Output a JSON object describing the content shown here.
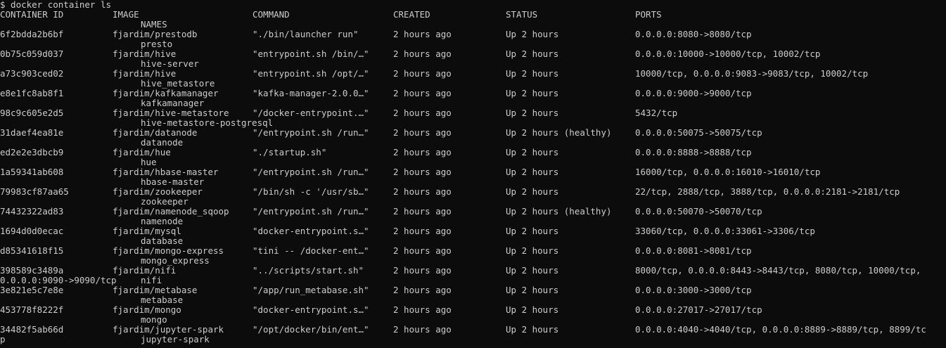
{
  "prompt": "$ docker container ls",
  "headers": {
    "container_id": "CONTAINER ID",
    "image": "IMAGE",
    "command": "COMMAND",
    "created": "CREATED",
    "status": "STATUS",
    "ports": "PORTS",
    "names": "NAMES"
  },
  "containers": [
    {
      "id": "6f2bdda2b6bf",
      "image": "fjardim/prestodb",
      "command": "\"./bin/launcher run\"",
      "created": "2 hours ago",
      "status": "Up 2 hours",
      "ports": "0.0.0.0:8080->8080/tcp",
      "ports_cont": "",
      "name": "presto"
    },
    {
      "id": "0b75c059d037",
      "image": "fjardim/hive",
      "command": "\"entrypoint.sh /bin/…\"",
      "created": "2 hours ago",
      "status": "Up 2 hours",
      "ports": "0.0.0.0:10000->10000/tcp, 10002/tcp",
      "ports_cont": "",
      "name": "hive-server"
    },
    {
      "id": "a73c903ced02",
      "image": "fjardim/hive",
      "command": "\"entrypoint.sh /opt/…\"",
      "created": "2 hours ago",
      "status": "Up 2 hours",
      "ports": "10000/tcp, 0.0.0.0:9083->9083/tcp, 10002/tcp",
      "ports_cont": "",
      "name": "hive_metastore"
    },
    {
      "id": "e8e1fc8ab8f1",
      "image": "fjardim/kafkamanager",
      "command": "\"kafka-manager-2.0.0…\"",
      "created": "2 hours ago",
      "status": "Up 2 hours",
      "ports": "0.0.0.0:9000->9000/tcp",
      "ports_cont": "",
      "name": "kafkamanager"
    },
    {
      "id": "98c9c605e2d5",
      "image": "fjardim/hive-metastore",
      "command": "\"/docker-entrypoint.…\"",
      "created": "2 hours ago",
      "status": "Up 2 hours",
      "ports": "5432/tcp",
      "ports_cont": "",
      "name": "hive-metastore-postgresql"
    },
    {
      "id": "31daef4ea81e",
      "image": "fjardim/datanode",
      "command": "\"/entrypoint.sh /run…\"",
      "created": "2 hours ago",
      "status": "Up 2 hours (healthy)",
      "ports": "0.0.0.0:50075->50075/tcp",
      "ports_cont": "",
      "name": "datanode"
    },
    {
      "id": "ed2e2e3dbcb9",
      "image": "fjardim/hue",
      "command": "\"./startup.sh\"",
      "created": "2 hours ago",
      "status": "Up 2 hours",
      "ports": "0.0.0.0:8888->8888/tcp",
      "ports_cont": "",
      "name": "hue"
    },
    {
      "id": "1a59341ab608",
      "image": "fjardim/hbase-master",
      "command": "\"/entrypoint.sh /run…\"",
      "created": "2 hours ago",
      "status": "Up 2 hours",
      "ports": "16000/tcp, 0.0.0.0:16010->16010/tcp",
      "ports_cont": "",
      "name": "hbase-master"
    },
    {
      "id": "79983cf87aa65",
      "image": "fjardim/zookeeper",
      "command": "\"/bin/sh -c '/usr/sb…\"",
      "created": "2 hours ago",
      "status": "Up 2 hours",
      "ports": "22/tcp, 2888/tcp, 3888/tcp, 0.0.0.0:2181->2181/tcp",
      "ports_cont": "",
      "name": "zookeeper"
    },
    {
      "id": "74432322ad83",
      "image": "fjardim/namenode_sqoop",
      "command": "\"/entrypoint.sh /run…\"",
      "created": "2 hours ago",
      "status": "Up 2 hours (healthy)",
      "ports": "0.0.0.0:50070->50070/tcp",
      "ports_cont": "",
      "name": "namenode"
    },
    {
      "id": "1694d0d0ecac",
      "image": "fjardim/mysql",
      "command": "\"docker-entrypoint.s…\"",
      "created": "2 hours ago",
      "status": "Up 2 hours",
      "ports": "33060/tcp, 0.0.0.0:33061->3306/tcp",
      "ports_cont": "",
      "name": "database"
    },
    {
      "id": "d85341618f15",
      "image": "fjardim/mongo-express",
      "command": "\"tini -- /docker-ent…\"",
      "created": "2 hours ago",
      "status": "Up 2 hours",
      "ports": "0.0.0.0:8081->8081/tcp",
      "ports_cont": "",
      "name": "mongo_express"
    },
    {
      "id": "398589c3489a",
      "image": "fjardim/nifi",
      "command": "\"../scripts/start.sh\"",
      "created": "2 hours ago",
      "status": "Up 2 hours",
      "ports": "8000/tcp, 0.0.0.0:8443->8443/tcp, 8080/tcp, 10000/tcp,",
      "ports_cont": "0.0.0.0:9090->9090/tcp",
      "name": "nifi"
    },
    {
      "id": "3e821e5c7e8e",
      "image": "fjardim/metabase",
      "command": "\"/app/run_metabase.sh\"",
      "created": "2 hours ago",
      "status": "Up 2 hours",
      "ports": "0.0.0.0:3000->3000/tcp",
      "ports_cont": "",
      "name": "metabase"
    },
    {
      "id": "453778f8222f",
      "image": "fjardim/mongo",
      "command": "\"docker-entrypoint.s…\"",
      "created": "2 hours ago",
      "status": "Up 2 hours",
      "ports": "0.0.0.0:27017->27017/tcp",
      "ports_cont": "",
      "name": "mongo"
    },
    {
      "id": "34482f5ab66d",
      "image": "fjardim/jupyter-spark",
      "command": "\"/opt/docker/bin/ent…\"",
      "created": "2 hours ago",
      "status": "Up 2 hours",
      "ports": "0.0.0.0:4040->4040/tcp, 0.0.0.0:8889->8889/tcp, 8899/tc",
      "ports_cont": "p",
      "name": "jupyter-spark"
    }
  ]
}
